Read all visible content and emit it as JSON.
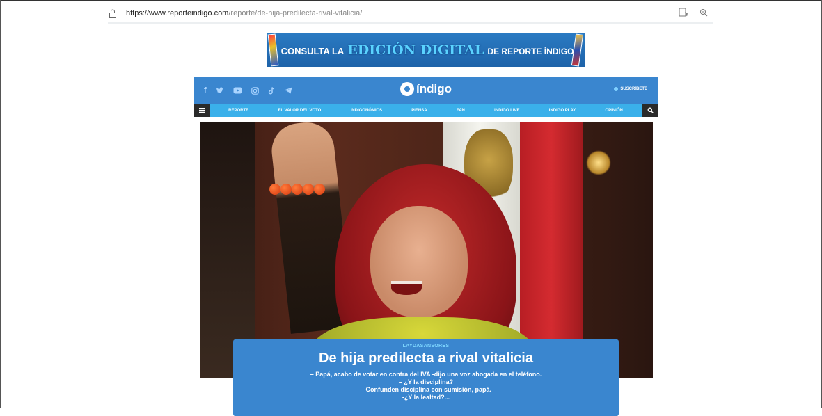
{
  "browser": {
    "url_host": "https://www.reporteindigo.com",
    "url_path": "/reporte/de-hija-predilecta-rival-vitalicia/"
  },
  "banner": {
    "text_1": "CONSULTA LA",
    "text_2": "EDICIÓN DIGITAL",
    "text_3": "DE REPORTE ÍNDIGO"
  },
  "header": {
    "socials": [
      "facebook-icon",
      "twitter-icon",
      "youtube-icon",
      "instagram-icon",
      "tiktok-icon",
      "telegram-icon"
    ],
    "logo_text": "índigo",
    "subscribe": "SUSCRÍBETE"
  },
  "nav": {
    "items": [
      "REPORTE",
      "EL VALOR DEL VOTO",
      "INDIGONÓMICS",
      "PIENSA",
      "FAN",
      "INDIGO LIVE",
      "INDIGO PLAY",
      "OPINIÓN"
    ]
  },
  "article": {
    "category": "LAYDASANSORES",
    "title": "De hija predilecta a rival vitalicia",
    "excerpt_lines": [
      "– Papá, acabo de votar en contra del IVA -dijo una voz ahogada en el teléfono.",
      "– ¿Y la disciplina?",
      "– Confunden disciplina con sumisión, papá.",
      "-¿Y la lealtad?..."
    ]
  },
  "colors": {
    "header_blue": "#3a86cf",
    "nav_cyan": "#3ab0ea",
    "dark": "#2a2a2a"
  }
}
